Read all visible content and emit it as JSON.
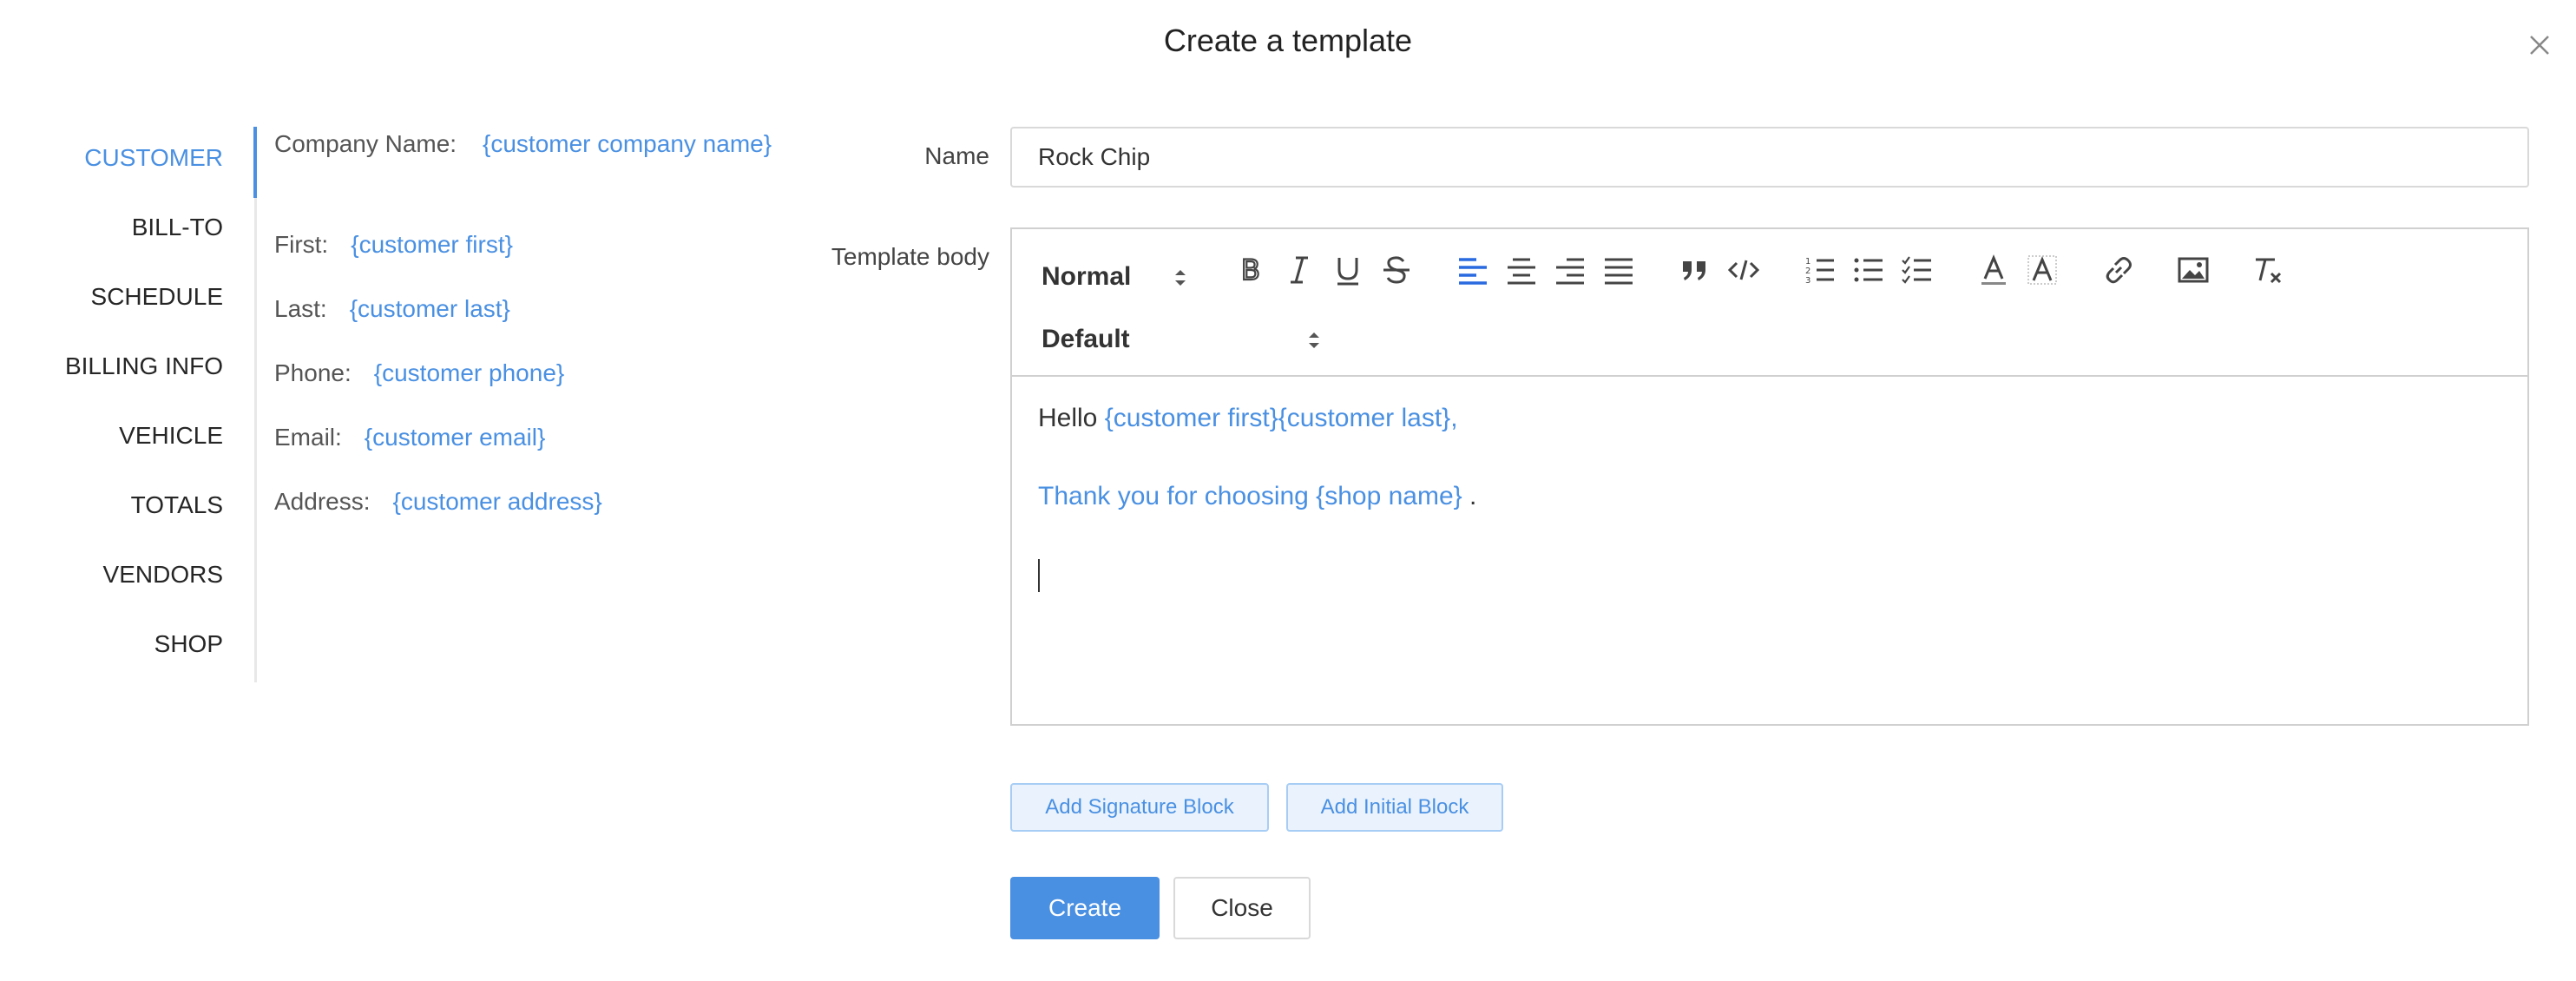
{
  "modal": {
    "title": "Create a template",
    "close_icon": "close-icon"
  },
  "tabs": [
    {
      "label": "CUSTOMER",
      "active": true
    },
    {
      "label": "BILL-TO"
    },
    {
      "label": "SCHEDULE"
    },
    {
      "label": "BILLING INFO"
    },
    {
      "label": "VEHICLE"
    },
    {
      "label": "TOTALS"
    },
    {
      "label": "VENDORS"
    },
    {
      "label": "SHOP"
    }
  ],
  "fields": [
    {
      "label": "Company Name:",
      "token": "{customer company name}"
    },
    {
      "label": "First:",
      "token": "{customer first}"
    },
    {
      "label": "Last:",
      "token": "{customer last}"
    },
    {
      "label": "Phone:",
      "token": "{customer phone}"
    },
    {
      "label": "Email:",
      "token": "{customer email}"
    },
    {
      "label": "Address:",
      "token": "{customer address}"
    }
  ],
  "form": {
    "name_label": "Name",
    "name_value": "Rock Chip",
    "body_label": "Template body"
  },
  "toolbar": {
    "header_select": "Normal",
    "font_select": "Default",
    "buttons": [
      "bold-icon",
      "italic-icon",
      "underline-icon",
      "strikethrough-icon",
      "align-left-icon",
      "align-center-icon",
      "align-right-icon",
      "align-justify-icon",
      "blockquote-icon",
      "code-icon",
      "ordered-list-icon",
      "bullet-list-icon",
      "check-list-icon",
      "font-color-icon",
      "background-color-icon",
      "link-icon",
      "image-icon",
      "clear-format-icon"
    ]
  },
  "editor": {
    "line1_prefix": "Hello ",
    "line1_tokens": "{customer first}{customer last},",
    "line2_blue": "Thank you for choosing {shop name}",
    "line2_suffix": " ."
  },
  "buttons": {
    "add_signature": "Add Signature Block",
    "add_initial": "Add Initial Block",
    "create": "Create",
    "close": "Close"
  },
  "colors": {
    "accent": "#4a90e2",
    "border": "#d9d9d9"
  }
}
